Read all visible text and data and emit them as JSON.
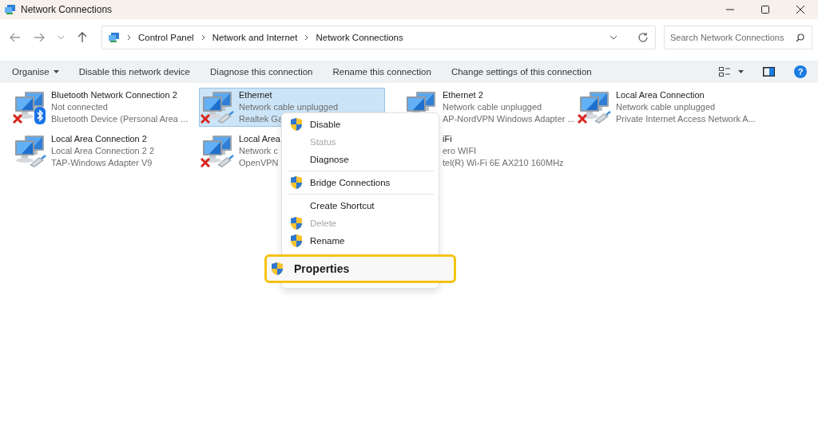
{
  "window": {
    "title": "Network Connections"
  },
  "address": {
    "breadcrumbs": [
      "Control Panel",
      "Network and Internet",
      "Network Connections"
    ]
  },
  "search": {
    "placeholder": "Search Network Connections"
  },
  "commands": [
    {
      "label": "Organise",
      "dropdown": true
    },
    {
      "label": "Disable this network device",
      "dropdown": false
    },
    {
      "label": "Diagnose this connection",
      "dropdown": false
    },
    {
      "label": "Rename this connection",
      "dropdown": false
    },
    {
      "label": "Change settings of this connection",
      "dropdown": false
    }
  ],
  "help": "?",
  "connections": [
    {
      "name": "Bluetooth Network Connection 2",
      "status": "Not connected",
      "device": "Bluetooth Device (Personal Area ...",
      "icon": true,
      "error": true,
      "bluetooth": true,
      "cable": false,
      "selected": false
    },
    {
      "name": "Ethernet",
      "status": "Network cable unplugged",
      "device": "Realtek Ga",
      "icon": true,
      "error": true,
      "bluetooth": false,
      "cable": true,
      "selected": true
    },
    {
      "name": "Ethernet 2",
      "status": "Network cable unplugged",
      "device": "AP-NordVPN Windows Adapter ...",
      "icon": true,
      "error": false,
      "bluetooth": false,
      "cable": false,
      "selected": false
    },
    {
      "name": "Local Area Connection",
      "status": "Network cable unplugged",
      "device": "Private Internet Access Network A...",
      "icon": true,
      "error": true,
      "bluetooth": false,
      "cable": true,
      "selected": false
    },
    {
      "name": "Local Area Connection 2",
      "status": "Local Area Connection 2 2",
      "device": "TAP-Windows Adapter V9",
      "icon": true,
      "error": false,
      "bluetooth": false,
      "cable": true,
      "selected": false
    },
    {
      "name": "Local Area",
      "status": "Network c",
      "device": "OpenVPN",
      "icon": true,
      "error": true,
      "bluetooth": false,
      "cable": true,
      "selected": false
    },
    {
      "name": "iFi",
      "status": "ero WIFI",
      "device": "tel(R) Wi-Fi 6E AX210 160MHz",
      "icon": false,
      "error": false,
      "bluetooth": false,
      "cable": false,
      "selected": false
    }
  ],
  "context_menu": [
    {
      "kind": "item",
      "label": "Disable",
      "shield": true,
      "disabled": false,
      "selected": false
    },
    {
      "kind": "item",
      "label": "Status",
      "shield": false,
      "disabled": true,
      "selected": false
    },
    {
      "kind": "item",
      "label": "Diagnose",
      "shield": false,
      "disabled": false,
      "selected": false
    },
    {
      "kind": "separator"
    },
    {
      "kind": "item",
      "label": "Bridge Connections",
      "shield": true,
      "disabled": false,
      "selected": false
    },
    {
      "kind": "separator"
    },
    {
      "kind": "item",
      "label": "Create Shortcut",
      "shield": false,
      "disabled": false,
      "selected": false
    },
    {
      "kind": "item",
      "label": "Delete",
      "shield": true,
      "disabled": true,
      "selected": false
    },
    {
      "kind": "item",
      "label": "Rename",
      "shield": true,
      "disabled": false,
      "selected": false
    },
    {
      "kind": "item",
      "label": "Properties",
      "shield": true,
      "disabled": false,
      "selected": true
    }
  ]
}
